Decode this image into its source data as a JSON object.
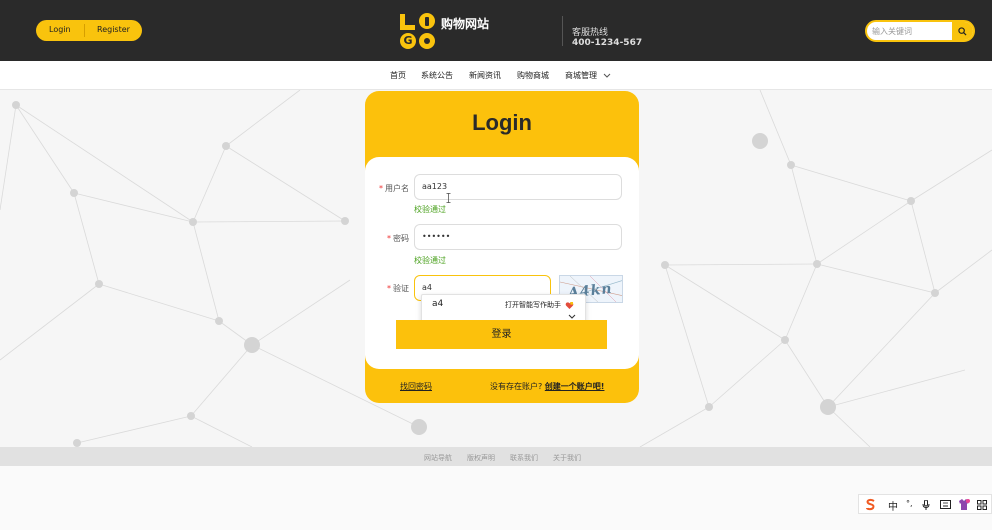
{
  "header": {
    "login_label": "Login",
    "register_label": "Register",
    "site_name": "购物网站",
    "hotline_label": "客服热线",
    "hotline_number": "400-1234-567",
    "search_placeholder": "输入关键词",
    "brand_color": "#f9c30d"
  },
  "nav": {
    "items": [
      "首页",
      "系统公告",
      "新闻资讯",
      "购物商城",
      "商城管理"
    ]
  },
  "login": {
    "title": "Login",
    "username_label": "用户名",
    "username_value": "aa123",
    "username_status": "校验通过",
    "password_label": "密码",
    "password_value": "••••••",
    "password_status": "校验通过",
    "captcha_label": "验证",
    "captcha_value": "a4",
    "captcha_image_text": "A4kn",
    "autocomplete_text": "a4",
    "autocomplete_hint": "打开智能写作助手",
    "submit_label": "登录",
    "forgot_label": "找回密码",
    "no_account_text": "没有存在账户?",
    "create_account_label": "创建一个账户吧!"
  },
  "footer": {
    "links": [
      "网站导航",
      "版权声明",
      "联系我们",
      "关于我们"
    ]
  },
  "ime": {
    "mode": "中",
    "punct": "°,"
  }
}
